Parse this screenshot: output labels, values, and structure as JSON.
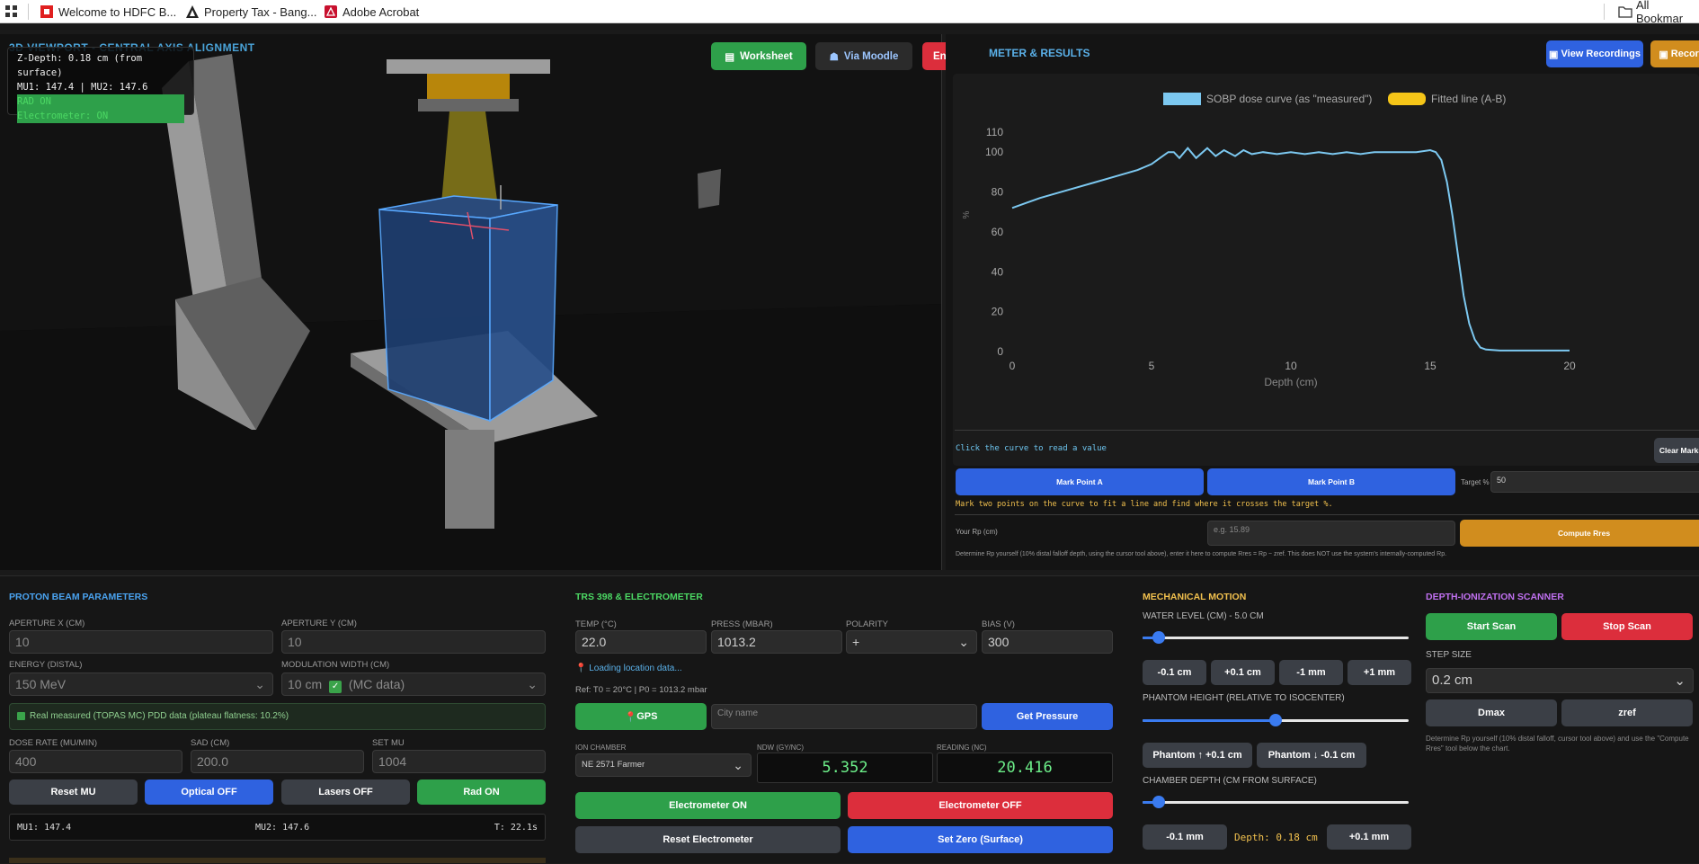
{
  "bookmarks": {
    "items": [
      {
        "label": "Welcome to HDFC B...",
        "icon": "hdfc-icon"
      },
      {
        "label": "Property Tax - Bang...",
        "icon": "bangalore-icon"
      },
      {
        "label": "Adobe Acrobat",
        "icon": "acrobat-icon"
      }
    ],
    "all_label": "All Bookmar"
  },
  "viewport": {
    "title": "3D VIEWPORT - CENTRAL AXIS ALIGNMENT",
    "hud": {
      "depth": "Z-Depth: 0.18 cm (from surface)",
      "mu": "MU1: 147.4 | MU2: 147.6",
      "rad": "RAD ON",
      "electrometer": "Electrometer: ON"
    },
    "buttons": {
      "worksheet": "Worksheet",
      "moodle": "Via Moodle",
      "end": "End Session"
    }
  },
  "results": {
    "title": "METER & RESULTS",
    "view_recordings": "View Recordings",
    "record": "Record",
    "legend": {
      "sobp": "SOBP dose curve (as \"measured\")",
      "fitted": "Fitted line (A-B)"
    },
    "click_hint": "Click the curve to read a value",
    "clear_marks": "Clear Marks",
    "mark_a": "Mark Point A",
    "mark_b": "Mark Point B",
    "target_label": "Target %",
    "target_value": "50",
    "instruction": "Mark two points on the curve to fit a line and find where it crosses the target %.",
    "rp_label": "Your Rp (cm)",
    "rp_placeholder": "e.g. 15.89",
    "compute": "Compute Rres",
    "note": "Determine Rp yourself (10% distal falloff depth, using the cursor tool above), enter it here to compute Rres = Rp − zref. This does NOT use the system's internally-computed Rp."
  },
  "chart_data": {
    "type": "line",
    "xlabel": "Depth (cm)",
    "ylabel": "%",
    "xlim": [
      0,
      20
    ],
    "ylim": [
      0,
      110
    ],
    "xticks": [
      0,
      5,
      10,
      15,
      20
    ],
    "yticks": [
      0,
      20,
      40,
      60,
      80,
      100,
      110
    ],
    "legend_position": "top-center",
    "series": [
      {
        "name": "SOBP dose curve (as \"measured\")",
        "color": "#7cc8f0",
        "x": [
          0,
          1,
          2,
          3,
          4,
          4.5,
          5,
          5.3,
          5.6,
          5.8,
          6.0,
          6.3,
          6.6,
          7.0,
          7.3,
          7.6,
          8.0,
          8.3,
          8.6,
          9.0,
          9.5,
          10,
          10.5,
          11,
          11.5,
          12,
          12.5,
          13,
          13.5,
          14,
          14.5,
          15,
          15.2,
          15.4,
          15.6,
          15.8,
          16.0,
          16.2,
          16.4,
          16.6,
          16.8,
          17.0,
          17.5,
          18,
          19,
          20
        ],
        "values": [
          72,
          77,
          81,
          85,
          89,
          91,
          94,
          97,
          100,
          100,
          97,
          102,
          97,
          102,
          98,
          101,
          98,
          101,
          99,
          100,
          99,
          100,
          99,
          100,
          99,
          100,
          99,
          100,
          100,
          100,
          100,
          101,
          100,
          96,
          85,
          68,
          48,
          28,
          14,
          6,
          2,
          1,
          0.5,
          0.5,
          0.5,
          0.5
        ]
      },
      {
        "name": "Fitted line (A-B)",
        "color": "#f5c518",
        "x": [],
        "values": []
      }
    ]
  },
  "beam": {
    "title": "PROTON BEAM PARAMETERS",
    "aperture_x_label": "APERTURE X (CM)",
    "aperture_x": "10",
    "aperture_y_label": "APERTURE Y (CM)",
    "aperture_y": "10",
    "energy_label": "ENERGY (DISTAL)",
    "energy": "150 MeV",
    "mod_label": "MODULATION WIDTH (CM)",
    "mod": "10 cm",
    "mod_tag": "(MC data)",
    "measured_note": "Real measured (TOPAS MC) PDD data (plateau flatness: 10.2%)",
    "dose_rate_label": "DOSE RATE (MU/MIN)",
    "dose_rate": "400",
    "sad_label": "SAD (CM)",
    "sad": "200.0",
    "set_mu_label": "SET MU",
    "set_mu": "1004",
    "reset_mu": "Reset MU",
    "optical": "Optical OFF",
    "lasers": "Lasers OFF",
    "rad": "Rad ON",
    "mu1": "MU1: 147.4",
    "mu2": "MU2: 147.6",
    "t": "T: 22.1s"
  },
  "trs": {
    "title": "TRS 398 & ELECTROMETER",
    "temp_label": "TEMP (°C)",
    "temp": "22.0",
    "press_label": "PRESS (MBAR)",
    "press": "1013.2",
    "polarity_label": "POLARITY",
    "polarity": "+",
    "bias_label": "BIAS (V)",
    "bias": "300",
    "loading": "Loading location data...",
    "ref": "Ref: T0 = 20°C | P0 = 1013.2 mbar",
    "gps": "GPS",
    "city_placeholder": "City name",
    "get_pressure": "Get Pressure",
    "chamber_label": "ION CHAMBER",
    "chamber": "NE 2571 Farmer",
    "ndw_label": "NDW (GY/NC)",
    "ndw": "5.352",
    "reading_label": "READING (NC)",
    "reading": "20.416",
    "elec_on": "Electrometer ON",
    "elec_off": "Electrometer OFF",
    "reset_elec": "Reset Electrometer",
    "set_zero": "Set Zero (Surface)"
  },
  "motion": {
    "title": "MECHANICAL MOTION",
    "water_label": "WATER LEVEL (CM) - 5.0 CM",
    "water_level": 0.06,
    "minus_cm": "-0.1 cm",
    "plus_cm": "+0.1 cm",
    "minus_mm": "-1 mm",
    "plus_mm": "+1 mm",
    "phantom_label": "PHANTOM HEIGHT (RELATIVE TO ISOCENTER)",
    "phantom_level": 0.5,
    "phantom_up": "Phantom ↑ +0.1 cm",
    "phantom_down": "Phantom ↓ -0.1 cm",
    "chamber_depth_label": "CHAMBER DEPTH (CM FROM SURFACE)",
    "chamber_level": 0.06,
    "depth_minus": "-0.1 mm",
    "depth_text": "Depth: 0.18 cm",
    "depth_plus": "+0.1 mm"
  },
  "scanner": {
    "title": "DEPTH-IONIZATION SCANNER",
    "start": "Start Scan",
    "stop": "Stop Scan",
    "step_label": "STEP SIZE",
    "step": "0.2 cm",
    "dmax": "Dmax",
    "zref": "zref",
    "note": "Determine Rp yourself (10% distal falloff, cursor tool above) and use the \"Compute Rres\" tool below the chart."
  },
  "colors": {
    "accent_blue": "#2f62e0",
    "green": "#2ea04a",
    "red": "#dc2e3c",
    "orange": "#d18d1e",
    "curve": "#7cc8f0"
  }
}
